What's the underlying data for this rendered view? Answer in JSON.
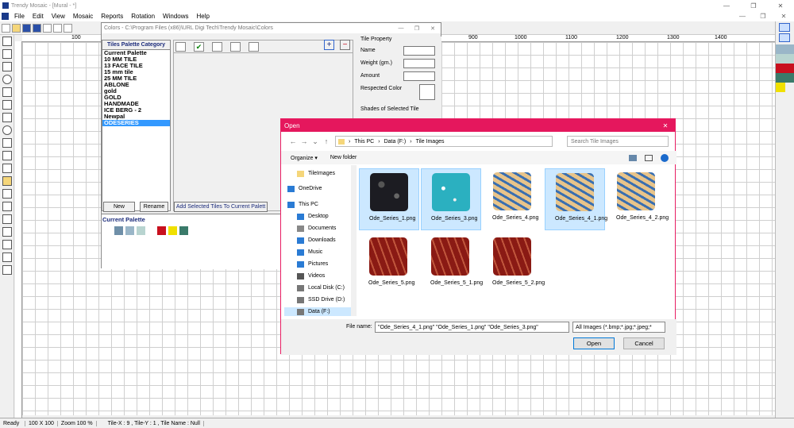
{
  "app": {
    "title": "Trendy Mosaic - [Mural - *]",
    "window_controls": [
      "—",
      "❐",
      "✕"
    ],
    "mdi_controls": [
      "—",
      "❐",
      "✕"
    ]
  },
  "menu": [
    "File",
    "Edit",
    "View",
    "Mosaic",
    "Reports",
    "Rotation",
    "Windows",
    "Help"
  ],
  "ruler": {
    "labels": [
      "100",
      "200",
      "900",
      "1000",
      "1100",
      "1200",
      "1300",
      "1400"
    ]
  },
  "status": {
    "ready": "Ready",
    "grid": "100 X 100",
    "zoom": "Zoom 100 %",
    "tile_info": "Tile-X : 9 , Tile-Y : 1 , Tile Name : Null"
  },
  "colors_window": {
    "title": "Colors - C:\\Program Files (x86)\\URL Digi Tech\\Trendy Mosaic\\Colors",
    "category_header": "Tiles Palette Category",
    "categories": [
      "Current Palette",
      "10 MM TILE",
      "13 FACE TILE",
      "15 mm tile",
      "25 MM TILE",
      "ABLONE",
      "gold",
      "GOLD",
      "HANDMADE",
      "ICE BERG - 2",
      "Newpal",
      "ODESERIES"
    ],
    "selected_category": "ODESERIES",
    "new_label": "New",
    "rename_label": "Rename",
    "add_selected_label": "Add Selected Tiles To Current Palett",
    "current_palette_label": "Current Palette",
    "palette_colors": [
      "#6f8fa8",
      "#9ab6c8",
      "#b8d4d0",
      "#c8101e",
      "#f0e000",
      "#3a7a6a"
    ],
    "tile_property": {
      "title": "Tile Property",
      "name_label": "Name",
      "weight_label": "Weight (gm.)",
      "amount_label": "Amount",
      "respected_color_label": "Respected Color",
      "shades_label": "Shades of Selected Tile"
    }
  },
  "open_dialog": {
    "title": "Open",
    "path": [
      "This PC",
      "Data (F:)",
      "Tile Images"
    ],
    "search_placeholder": "Search Tile Images",
    "organize_label": "Organize ▾",
    "new_folder_label": "New folder",
    "nav_items": [
      {
        "label": "TileImages",
        "icon": "folder-icon"
      },
      {
        "label": "OneDrive",
        "icon": "cloud-icon"
      },
      {
        "label": "This PC",
        "icon": "computer-icon"
      },
      {
        "label": "Desktop",
        "icon": "desktop-icon"
      },
      {
        "label": "Documents",
        "icon": "document-icon"
      },
      {
        "label": "Downloads",
        "icon": "download-icon"
      },
      {
        "label": "Music",
        "icon": "music-icon"
      },
      {
        "label": "Pictures",
        "icon": "picture-icon"
      },
      {
        "label": "Videos",
        "icon": "video-icon"
      },
      {
        "label": "Local Disk (C:)",
        "icon": "drive-icon"
      },
      {
        "label": "SSD Drive (D:)",
        "icon": "drive-icon"
      },
      {
        "label": "Data (F:)",
        "icon": "drive-icon"
      }
    ],
    "files": [
      {
        "name": "Ode_Series_1.png",
        "selected": true,
        "style": "dark-stars"
      },
      {
        "name": "Ode_Series_3.png",
        "selected": true,
        "style": "cyan-speckle"
      },
      {
        "name": "Ode_Series_4.png",
        "selected": false,
        "style": "blue-wave"
      },
      {
        "name": "Ode_Series_4_1.png",
        "selected": true,
        "style": "blue-wave"
      },
      {
        "name": "Ode_Series_4_2.png",
        "selected": false,
        "style": "blue-wave"
      },
      {
        "name": "Ode_Series_5.png",
        "selected": false,
        "style": "red-stripe"
      },
      {
        "name": "Ode_Series_5_1.png",
        "selected": false,
        "style": "red-stripe"
      },
      {
        "name": "Ode_Series_5_2.png",
        "selected": false,
        "style": "red-stripe"
      }
    ],
    "file_name_label": "File name:",
    "file_name_value": "\"Ode_Series_4_1.png\" \"Ode_Series_1.png\" \"Ode_Series_3.png\"",
    "filter_value": "All Images (*.bmp;*.jpg;*.jpeg;*",
    "open_label": "Open",
    "cancel_label": "Cancel"
  }
}
